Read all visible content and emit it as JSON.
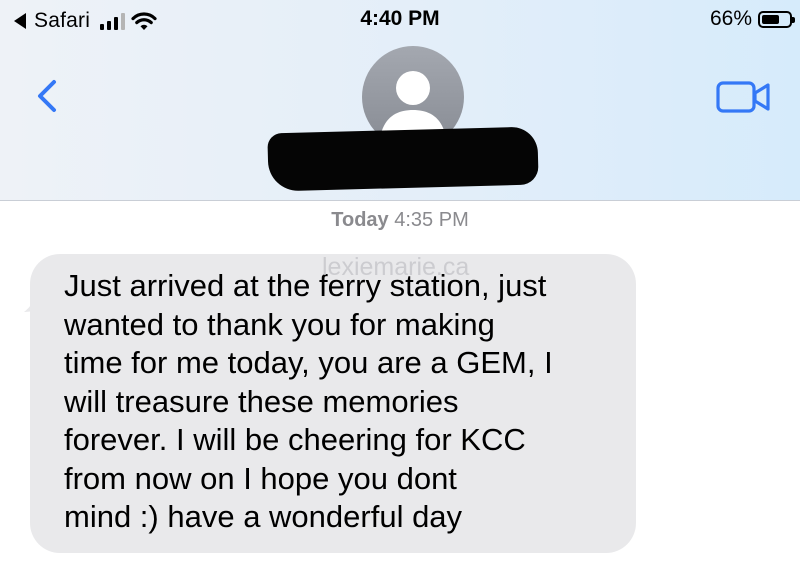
{
  "status_bar": {
    "back_app": "Safari",
    "time": "4:40 PM",
    "battery": "66%",
    "battery_level": 0.66
  },
  "nav": {
    "back_icon": "chevron-left-icon",
    "video_icon": "video-camera-icon",
    "accent_color": "#3478f6"
  },
  "conversation": {
    "timestamp_day": "Today",
    "timestamp_time": "4:35 PM",
    "watermark": "lexiemarie.ca",
    "message_lines": [
      "Just arrived at the ferry station, just",
      "wanted to thank you for making",
      "time for me today, you are a GEM, I",
      "will treasure these memories",
      "forever. I will be cheering for KCC",
      "from now on I hope you dont",
      "mind :) have a wonderful day"
    ]
  }
}
